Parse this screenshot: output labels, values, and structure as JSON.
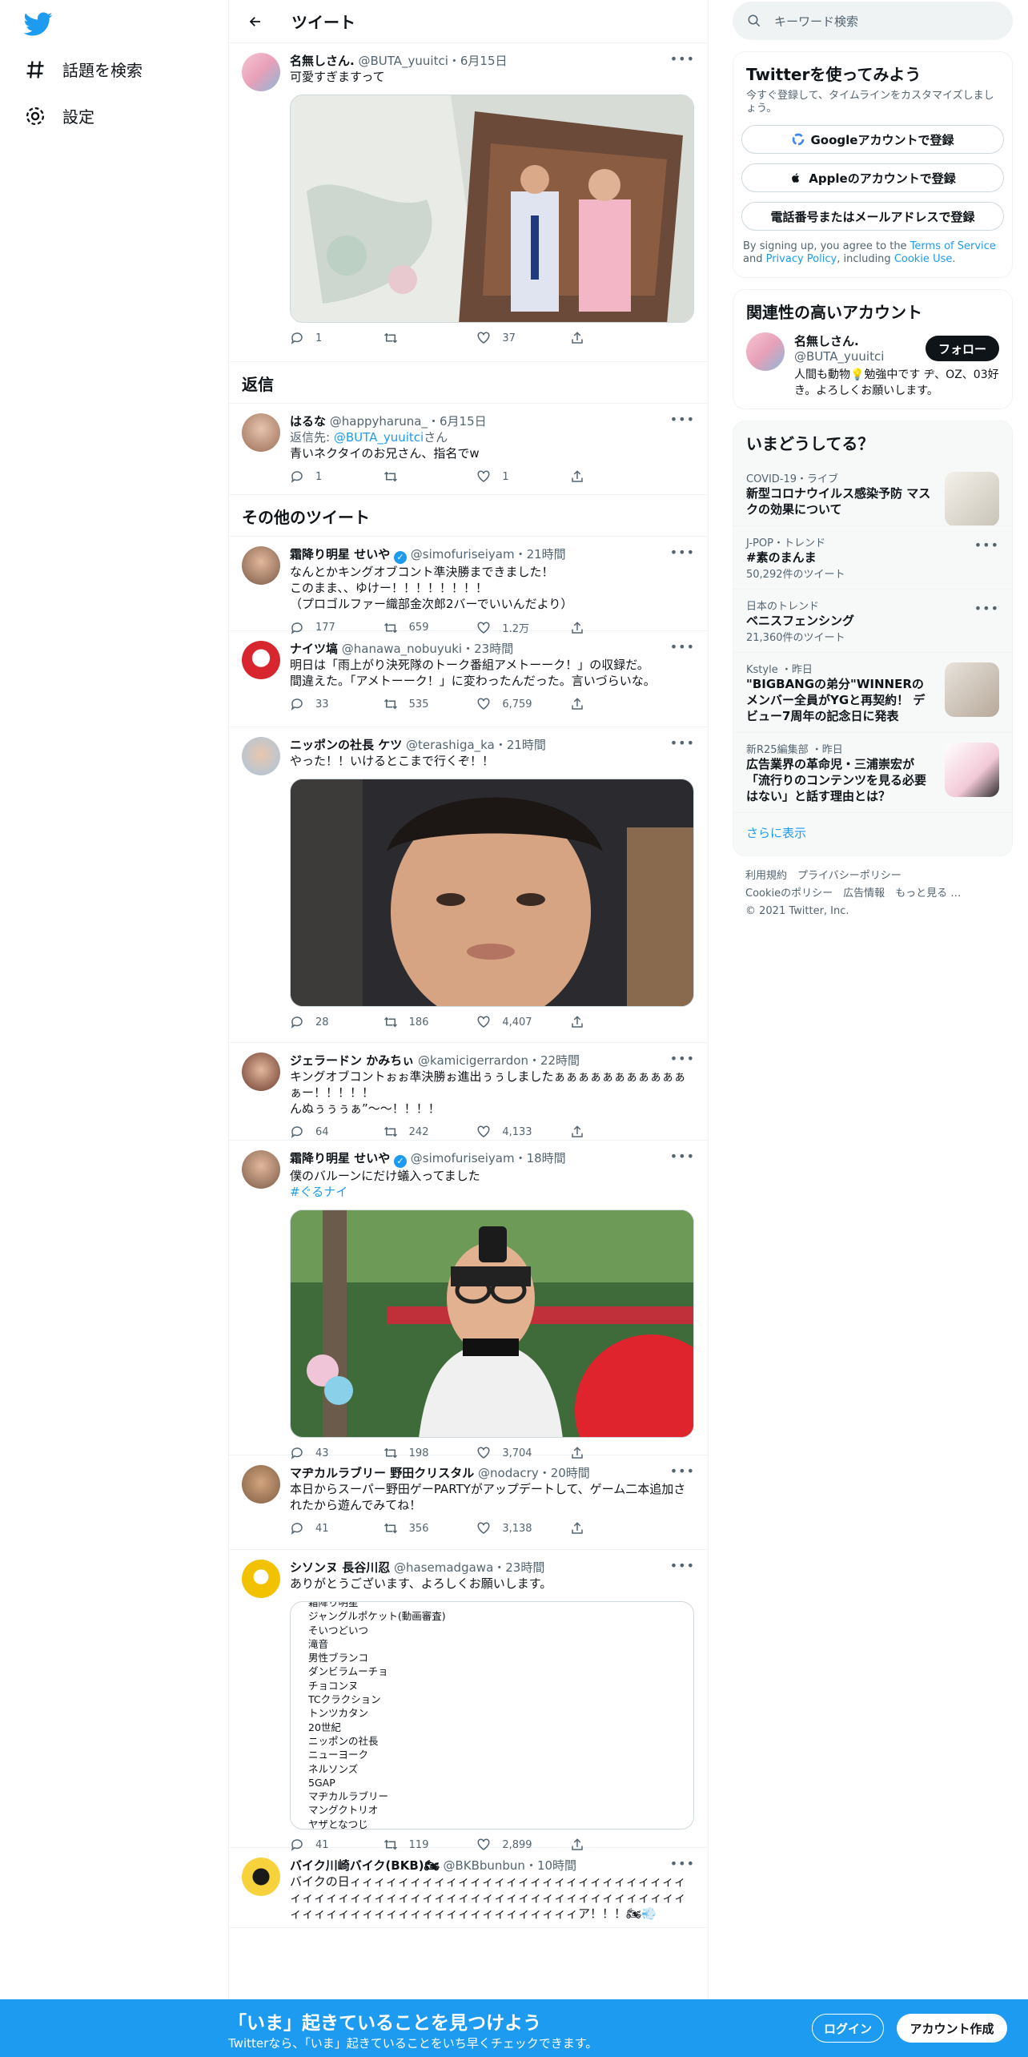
{
  "nav": {
    "search_label": "話題を検索",
    "settings_label": "設定"
  },
  "header": {
    "title": "ツイート"
  },
  "main_tweet": {
    "name": "名無しさん.",
    "handle": "@BUTA_yuuitci",
    "date": "・6月15日",
    "text": "可愛すぎますって",
    "replies": "1",
    "retweets": "",
    "likes": "37"
  },
  "reply_section": "返信",
  "reply": {
    "name": "はるな",
    "handle": "@happyharuna_",
    "date": "・6月15日",
    "reply_to_label": "返信先: ",
    "reply_to": "@BUTA_yuuitci",
    "reply_to_suffix": "さん",
    "text": "青いネクタイのお兄さん、指名でw",
    "replies": "1",
    "retweets": "",
    "likes": "1"
  },
  "other_section": "その他のツイート",
  "tweets": [
    {
      "name": "霜降り明星 せいや",
      "handle": "@simofuriseiyam",
      "date": "・21時間",
      "text": "なんとかキングオブコント準決勝まできました！\nこのまま、、ゆけー！！！！！！！！\n（プロゴルファー織部金次郎2バーでいいんだより）",
      "replies": "177",
      "retweets": "659",
      "likes": "1.2万"
    },
    {
      "name": "ナイツ塙",
      "handle": "@hanawa_nobuyuki",
      "date": "・23時間",
      "text": "明日は「雨上がり決死隊のトーク番組アメトーーク！」の収録だ。\n間違えた。「アメトーーク！」に変わったんだった。言いづらいな。",
      "replies": "33",
      "retweets": "535",
      "likes": "6,759"
    },
    {
      "name": "ニッポンの社長 ケツ",
      "handle": "@terashiga_ka",
      "date": "・21時間",
      "text": "やった！！いけるとこまで行くぞ！！",
      "replies": "28",
      "retweets": "186",
      "likes": "4,407"
    },
    {
      "name": "ジェラードン かみちぃ",
      "handle": "@kamicigerrardon",
      "date": "・22時間",
      "text": "キングオブコントぉぉ準決勝ぉ進出ぅぅしましたぁぁぁぁぁぁぁぁぁぁぁぁー！！！！！\nんぬぅぅぅぁ”〜〜！！！！",
      "replies": "64",
      "retweets": "242",
      "likes": "4,133"
    },
    {
      "name": "霜降り明星 せいや",
      "handle": "@simofuriseiyam",
      "date": "・18時間",
      "text": "僕のバルーンにだけ蟻入ってました",
      "hashtag": "#ぐるナイ",
      "replies": "43",
      "retweets": "198",
      "likes": "3,704"
    },
    {
      "name": "マヂカルラブリー 野田クリスタル",
      "handle": "@nodacry",
      "date": "・20時間",
      "text": "本日からスーパー野田ゲーPARTYがアップデートして、ゲーム二本追加されたから遊んでみてね！",
      "replies": "41",
      "retweets": "356",
      "likes": "3,138"
    },
    {
      "name": "シソンヌ 長谷川忍",
      "handle": "@hasemadgawa",
      "date": "・23時間",
      "text": "ありがとうございます、よろしくお願いします。",
      "list": [
        "霜降り明星",
        "ジャングルポケット(動画審査)",
        "そいつどいつ",
        "滝音",
        "男性ブランコ",
        "ダンビラムーチョ",
        "チョコンヌ",
        "TCクラクション",
        "トンツカタン",
        "20世紀",
        "ニッポンの社長",
        "ニューヨーク",
        "ネルソンズ",
        "5GAP",
        "マヂカルラブリー",
        "マングクトリオ",
        "ヤザとなつじ"
      ],
      "replies": "41",
      "retweets": "119",
      "likes": "2,899"
    },
    {
      "name": "バイク川崎バイク(BKB)🏍",
      "handle": "@BKBbunbun",
      "date": "・10時間",
      "text": "バイクの日ィィィィィィィィィィィィィィィィィィィィィィィィィィィィィィィィィィィィィィィィィィィィィィィィィィィィィィィィィィィィィィィィィィィィィィィィィィィィィィィィィィィィィア！！！🏍💨"
    }
  ],
  "search": {
    "placeholder": "キーワード検索"
  },
  "signup": {
    "title": "Twitterを使ってみよう",
    "subtitle": "今すぐ登録して、タイムラインをカスタマイズしましょう。",
    "google": "Googleアカウントで登録",
    "apple": "Appleのアカウントで登録",
    "phone": "電話番号またはメールアドレスで登録",
    "legal_1": "By signing up, you agree to the ",
    "tos": "Terms of Service",
    "legal_2": " and ",
    "privacy": "Privacy Policy",
    "legal_3": ", including ",
    "cookie": "Cookie Use",
    "legal_4": "."
  },
  "related": {
    "title": "関連性の高いアカウント",
    "name": "名無しさん.",
    "handle": "@BUTA_yuuitci",
    "bio": "人間も動物💡勉強中です ヂ、OZ、03好き。よろしくお願いします。",
    "follow": "フォロー"
  },
  "trends": {
    "title": "いまどうしてる？",
    "items": [
      {
        "cat": "COVID-19・ライブ",
        "title": "新型コロナウイルス感染予防 マスクの効果について",
        "count": ""
      },
      {
        "cat": "J-POP・トレンド",
        "title": "#素のまんま",
        "count": "50,292件のツイート"
      },
      {
        "cat": "日本のトレンド",
        "title": "ベニスフェンシング",
        "count": "21,360件のツイート"
      },
      {
        "cat": "Kstyle ・昨日",
        "title": "\"BIGBANGの弟分\"WINNERのメンバー全員がYGと再契約！ デビュー7周年の記念日に発表",
        "count": ""
      },
      {
        "cat": "新R25編集部 ・昨日",
        "title": "広告業界の革命児・三浦崇宏が「流行りのコンテンツを見る必要はない」と話す理由とは？",
        "count": ""
      }
    ],
    "more": "さらに表示"
  },
  "footer": {
    "l1": "利用規約　プライバシーポリシー",
    "l2": "Cookieのポリシー　広告情報　もっと見る …",
    "l3": "© 2021 Twitter, Inc."
  },
  "bottom": {
    "title": "「いま」起きていることを見つけよう",
    "subtitle": "Twitterなら、「いま」起きていることをいち早くチェックできます。",
    "login": "ログイン",
    "signup": "アカウント作成"
  },
  "colors": {
    "accent": "#1d9bf0",
    "text": "#0f1419",
    "muted": "#536471"
  }
}
